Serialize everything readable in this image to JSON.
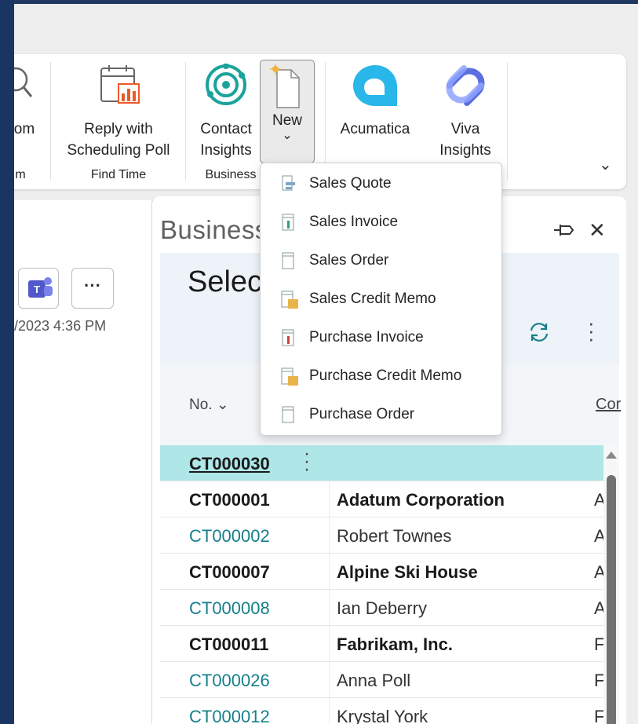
{
  "ribbon": {
    "search_label": "om",
    "search_group": "m",
    "reply_line1": "Reply with",
    "reply_line2": "Scheduling Poll",
    "find_time_group": "Find Time",
    "contact_line1": "Contact",
    "contact_line2": "Insights",
    "business_group": "Business",
    "new_label": "New",
    "new_chevron": "⌄",
    "acumatica_label": "Acumatica",
    "viva_line1": "Viva",
    "viva_line2": "Insights",
    "expand_chevron": "⌄"
  },
  "contact": {
    "more_label": "···",
    "date_text": "/2023 4:36 PM"
  },
  "pane": {
    "title": "Business",
    "select_title": "Selec",
    "col_no": "No. ⌄",
    "col_cor": "Cor",
    "close_label": "✕"
  },
  "rows": [
    {
      "no": "CT000030",
      "name": "",
      "type": ""
    },
    {
      "no": "CT000001",
      "name": "Adatum Corporation",
      "type": "A"
    },
    {
      "no": "CT000002",
      "name": "Robert Townes",
      "type": "A"
    },
    {
      "no": "CT000007",
      "name": "Alpine Ski House",
      "type": "A"
    },
    {
      "no": "CT000008",
      "name": "Ian Deberry",
      "type": "A"
    },
    {
      "no": "CT000011",
      "name": "Fabrikam, Inc.",
      "type": "F"
    },
    {
      "no": "CT000026",
      "name": "Anna Poll",
      "type": "F"
    },
    {
      "no": "CT000012",
      "name": "Krystal York",
      "type": "F"
    }
  ],
  "dropdown": {
    "items": [
      {
        "label": "Sales Quote",
        "icon": "sales-quote-icon"
      },
      {
        "label": "Sales Invoice",
        "icon": "sales-invoice-icon"
      },
      {
        "label": "Sales Order",
        "icon": "sales-order-icon"
      },
      {
        "label": "Sales Credit Memo",
        "icon": "sales-credit-memo-icon"
      },
      {
        "label": "Purchase Invoice",
        "icon": "purchase-invoice-icon"
      },
      {
        "label": "Purchase Credit Memo",
        "icon": "purchase-credit-memo-icon"
      },
      {
        "label": "Purchase Order",
        "icon": "purchase-order-icon"
      }
    ]
  },
  "colors": {
    "accent_teal": "#16808a",
    "selected_row": "#afe6e8",
    "acumatica_blue": "#29b6e8",
    "contact_teal": "#1aa39a",
    "viva_purple": "#5b6fe0"
  }
}
